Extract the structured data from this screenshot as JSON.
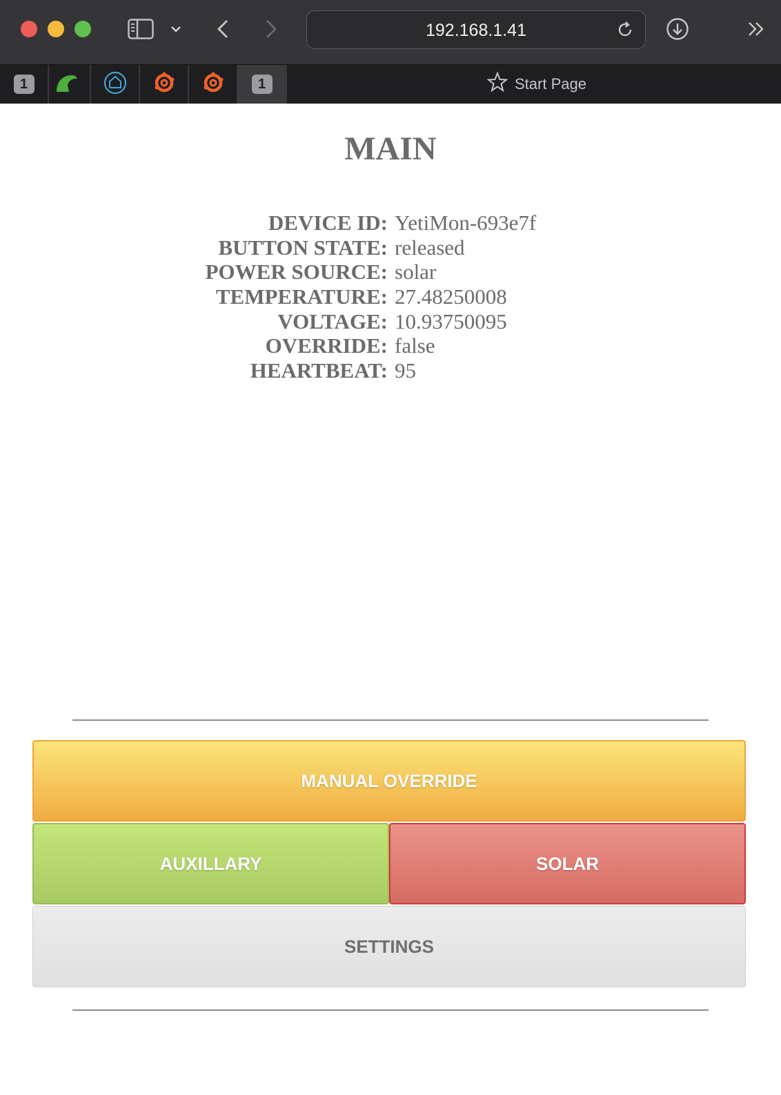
{
  "browser": {
    "url": "192.168.1.41",
    "tabs": [
      {
        "badge": "1",
        "icon": "number-badge-icon"
      },
      {
        "icon": "green-arc-icon"
      },
      {
        "icon": "home-assistant-icon"
      },
      {
        "icon": "grafana-icon"
      },
      {
        "icon": "grafana-icon"
      },
      {
        "badge": "1",
        "icon": "number-badge-icon",
        "active": true
      }
    ],
    "start_page_label": "Start Page"
  },
  "page": {
    "title": "MAIN",
    "fields": [
      {
        "label": "DEVICE ID:",
        "value": "YetiMon-693e7f"
      },
      {
        "label": "BUTTON STATE:",
        "value": "released"
      },
      {
        "label": "POWER SOURCE:",
        "value": "solar"
      },
      {
        "label": "TEMPERATURE:",
        "value": "27.48250008"
      },
      {
        "label": "VOLTAGE:",
        "value": "10.93750095"
      },
      {
        "label": "OVERRIDE:",
        "value": "false"
      },
      {
        "label": "HEARTBEAT:",
        "value": "95"
      }
    ],
    "buttons": {
      "manual_override": "MANUAL OVERRIDE",
      "auxillary": "AUXILLARY",
      "solar": "SOLAR",
      "settings": "SETTINGS"
    }
  },
  "colors": {
    "override": "#f5c25a",
    "auxillary": "#b6d76e",
    "solar": "#e07e76",
    "settings": "#e6e6e6",
    "text": "#6b6b6b"
  }
}
